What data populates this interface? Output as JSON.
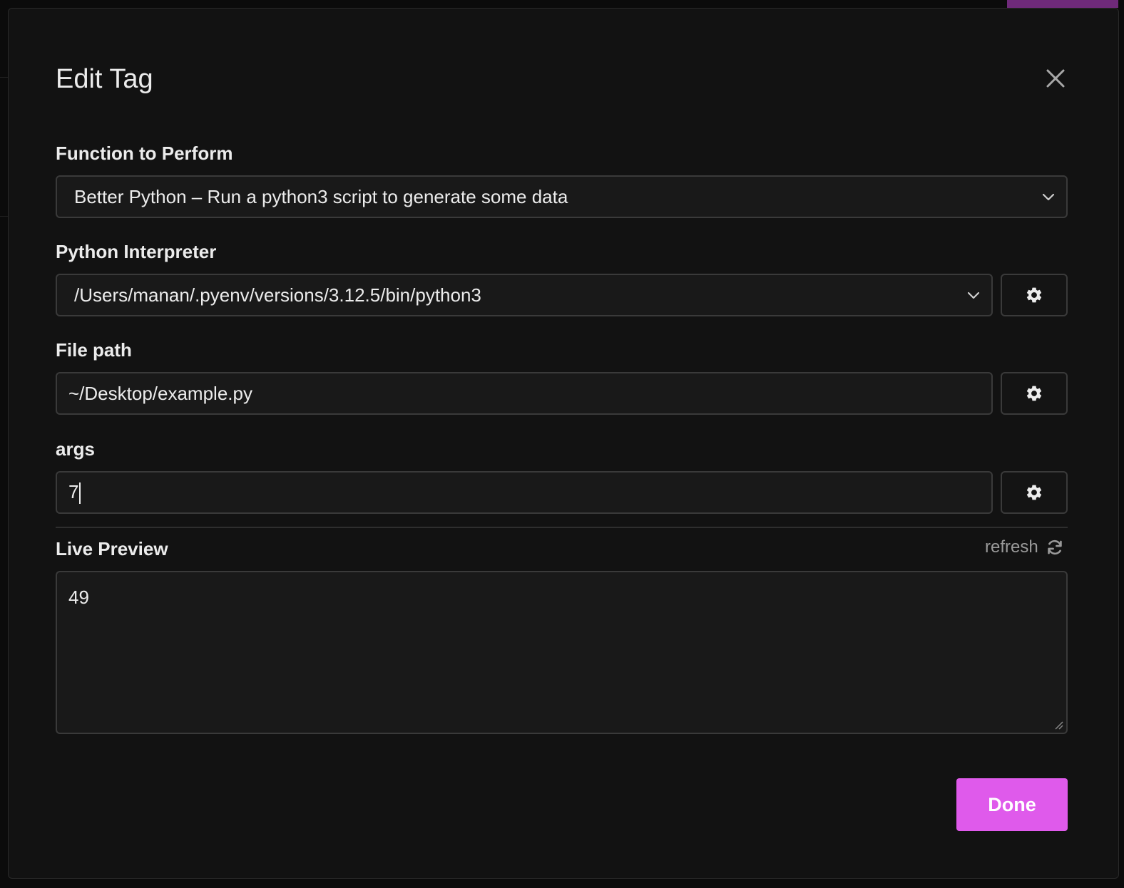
{
  "modal": {
    "title": "Edit Tag"
  },
  "function_field": {
    "label": "Function to Perform",
    "selected": "Better Python – Run a python3 script to generate some data"
  },
  "interpreter_field": {
    "label": "Python Interpreter",
    "selected": "/Users/manan/.pyenv/versions/3.12.5/bin/python3"
  },
  "file_path_field": {
    "label": "File path",
    "value": "~/Desktop/example.py"
  },
  "args_field": {
    "label": "args",
    "value": "7"
  },
  "live_preview": {
    "label": "Live Preview",
    "refresh_label": "refresh",
    "output": "49"
  },
  "footer": {
    "done_label": "Done"
  },
  "colors": {
    "accent": "#df5aeb",
    "background": "#121212"
  },
  "icons": [
    "close-icon",
    "chevron-down-icon",
    "gear-icon",
    "refresh-icon",
    "resize-grip-icon"
  ]
}
